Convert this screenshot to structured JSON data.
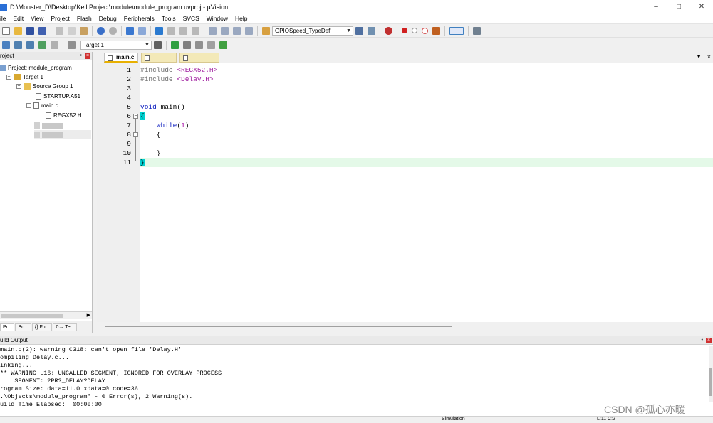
{
  "window": {
    "title": "D:\\Monster_D\\Desktop\\Keil Project\\module\\module_program.uvproj - µVision"
  },
  "menu": [
    "ile",
    "Edit",
    "View",
    "Project",
    "Flash",
    "Debug",
    "Peripherals",
    "Tools",
    "SVCS",
    "Window",
    "Help"
  ],
  "toolbar": {
    "function_combo": "GPIOSpeed_TypeDef",
    "target_combo": "Target 1"
  },
  "project_panel": {
    "title": "roject",
    "tree": {
      "project": "Project: module_program",
      "target": "Target 1",
      "group": "Source Group 1",
      "file_startup": "STARTUP.A51",
      "file_main": "main.c",
      "file_header": "REGX52.H"
    },
    "tabs": [
      "Pr...",
      "Bo...",
      "{} Fu...",
      "0→ Te..."
    ]
  },
  "editor": {
    "active_tab": "main.c",
    "line_numbers": [
      "1",
      "2",
      "3",
      "4",
      "5",
      "6",
      "7",
      "8",
      "9",
      "10",
      "11"
    ],
    "lines": [
      {
        "pp": "#include",
        "inc": "<REGX52.H>"
      },
      {
        "pp": "#include",
        "inc": "<Delay.H>"
      },
      {
        "text": ""
      },
      {
        "text": ""
      },
      {
        "kw": "void",
        "rest": " main()"
      },
      {
        "brace": "{"
      },
      {
        "kw": "while",
        "pre": "    ",
        "open": "(",
        "num": "1",
        "close": ")"
      },
      {
        "text": "    {"
      },
      {
        "text": ""
      },
      {
        "text": "    }"
      },
      {
        "brace": "}"
      }
    ]
  },
  "build_output": {
    "title": "uild Output",
    "lines": [
      "main.c(2): warning C318: can't open file 'Delay.H'",
      "ompiling Delay.c...",
      "inking...",
      "** WARNING L16: UNCALLED SEGMENT, IGNORED FOR OVERLAY PROCESS",
      "    SEGMENT: ?PR?_DELAY?DELAY",
      "rogram Size: data=11.0 xdata=0 code=36",
      ".\\Objects\\module_program\" - 0 Error(s), 2 Warning(s).",
      "uild Time Elapsed:  00:00:00"
    ]
  },
  "status": {
    "mode": "Simulation",
    "position": "L:11 C:2"
  },
  "watermark": "CSDN @孤心亦暖"
}
